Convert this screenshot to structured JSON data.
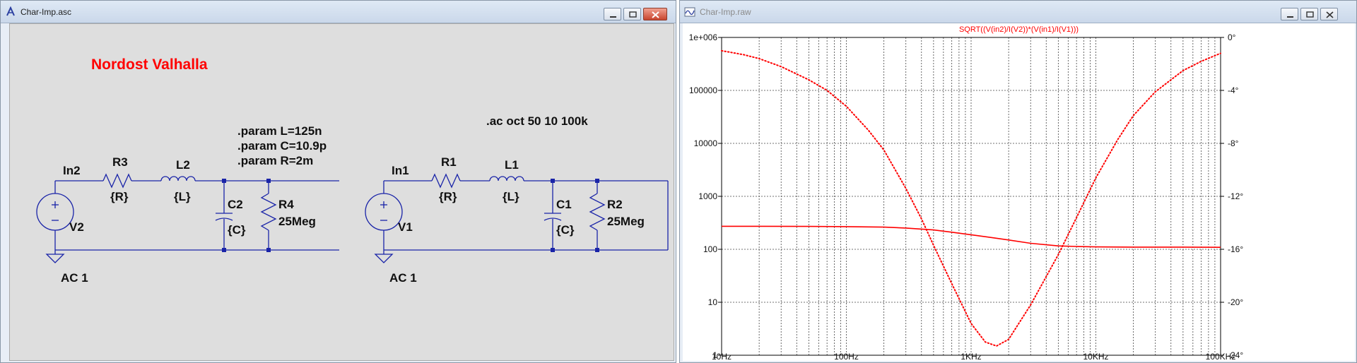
{
  "left_window": {
    "title": "Char-Imp.asc",
    "schematic": {
      "title": "Nordost Valhalla",
      "params": [
        ".param L=125n",
        ".param C=10.9p",
        ".param R=2m"
      ],
      "ac_directive": ".ac oct 50 10 100k",
      "circuit_a": {
        "node": "In2",
        "resistor": {
          "name": "R3",
          "value": "{R}"
        },
        "inductor": {
          "name": "L2",
          "value": "{L}"
        },
        "capacitor": {
          "name": "C2",
          "value": "{C}"
        },
        "load": {
          "name": "R4",
          "value": "25Meg"
        },
        "source": {
          "name": "V2",
          "value": "AC 1"
        }
      },
      "circuit_b": {
        "node": "In1",
        "resistor": {
          "name": "R1",
          "value": "{R}"
        },
        "inductor": {
          "name": "L1",
          "value": "{L}"
        },
        "capacitor": {
          "name": "C1",
          "value": "{C}"
        },
        "load": {
          "name": "R2",
          "value": "25Meg"
        },
        "source": {
          "name": "V1",
          "value": "AC 1"
        }
      }
    }
  },
  "right_window": {
    "title": "Char-Imp.raw",
    "chart_data": {
      "type": "line",
      "title": "SQRT((V(in2)/I(V2))*(V(in1)/I(V1)))",
      "x_scale": "log",
      "xlim": [
        10,
        100000
      ],
      "x_tick_labels": [
        "10Hz",
        "100Hz",
        "1KHz",
        "10KHz",
        "100KHz"
      ],
      "y_scale": "log",
      "ylim": [
        1,
        1000000
      ],
      "y_tick_labels": [
        "1e+006",
        "100000",
        "10000",
        "1000",
        "100",
        "10",
        "1"
      ],
      "y2_unit": "°",
      "y2lim": [
        -24,
        0
      ],
      "y2_tick_labels": [
        "0°",
        "-4°",
        "-8°",
        "-12°",
        "-16°",
        "-20°",
        "-24°"
      ],
      "grid": true,
      "series": [
        {
          "role": "magnitude",
          "color": "#ff0000",
          "line": "solid",
          "axis": "left",
          "x": [
            10,
            20,
            50,
            100,
            200,
            300,
            500,
            700,
            1000,
            1500,
            2000,
            3000,
            5000,
            7000,
            10000,
            20000,
            50000,
            100000
          ],
          "y": [
            272,
            272,
            270,
            268,
            262,
            252,
            232,
            210,
            188,
            165,
            150,
            130,
            116,
            113,
            111,
            110,
            110,
            109
          ]
        },
        {
          "role": "phase",
          "color": "#ff0000",
          "line": "dotted",
          "axis": "right",
          "x": [
            10,
            15,
            20,
            30,
            50,
            70,
            100,
            150,
            200,
            300,
            400,
            500,
            700,
            1000,
            1300,
            1600,
            2000,
            3000,
            5000,
            7000,
            10000,
            15000,
            20000,
            30000,
            50000,
            70000,
            100000
          ],
          "y": [
            -1.0,
            -1.3,
            -1.6,
            -2.2,
            -3.2,
            -4.0,
            -5.2,
            -7.0,
            -8.5,
            -11.4,
            -13.7,
            -15.7,
            -18.6,
            -21.6,
            -23.0,
            -23.3,
            -22.8,
            -20.2,
            -16.4,
            -13.6,
            -10.6,
            -7.7,
            -5.9,
            -4.1,
            -2.5,
            -1.8,
            -1.2
          ]
        }
      ]
    }
  }
}
